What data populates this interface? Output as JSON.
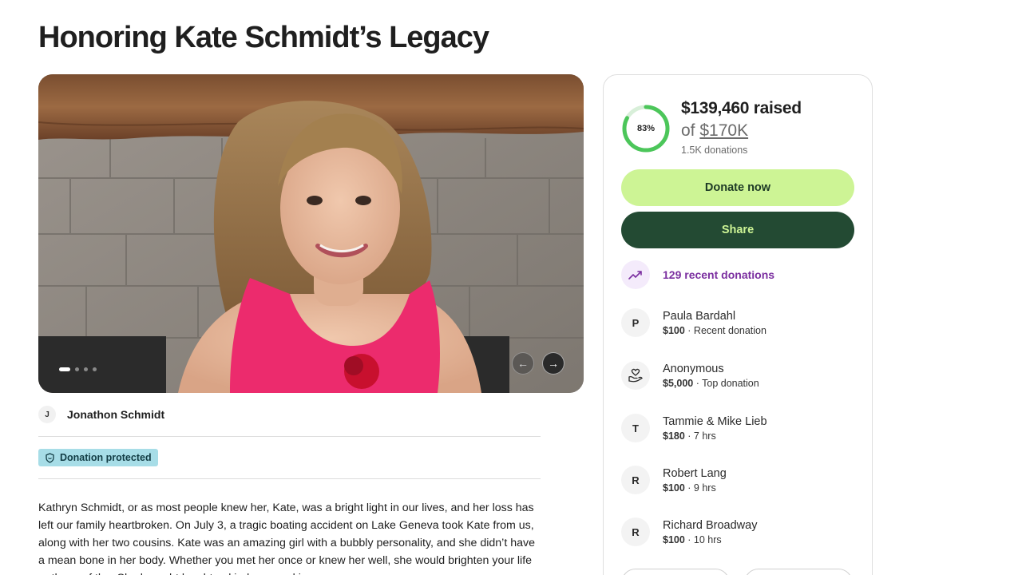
{
  "page": {
    "title": "Honoring Kate Schmidt’s Legacy"
  },
  "gallery": {
    "slides": 4,
    "active_index": 0,
    "prev_icon": "arrow-left-icon",
    "next_icon": "arrow-right-icon"
  },
  "organizer": {
    "initial": "J",
    "name": "Jonathon Schmidt"
  },
  "badge": {
    "label": "Donation protected",
    "icon": "shield-icon",
    "color": "#a7dde7"
  },
  "story": {
    "text": "Kathryn Schmidt, or as most people knew her, Kate, was a bright light in our lives, and her loss has left our family heartbroken. On July 3, a tragic boating accident on Lake Geneva took Kate from us, along with her two cousins. Kate was an amazing girl with a bubbly personality, and she didn’t have a mean bone in her body. Whether you met her once or knew her well, she would brighten your life or those of the. She brought laughter, kindness and joy"
  },
  "fundraiser": {
    "percent_label": "83%",
    "progress": 0.83,
    "raised": "$139,460 raised",
    "goal_prefix": "of",
    "goal_amount": "$170K",
    "donation_count": "1.5K donations",
    "donate_label": "Donate now",
    "share_label": "Share",
    "recent_label": "129 recent donations",
    "accent_color": "#cdf495",
    "dark_color": "#234a33",
    "progress_color": "#4cc65a"
  },
  "donors": [
    {
      "initial": "P",
      "name": "Paula Bardahl",
      "amount": "$100",
      "note": " · Recent donation"
    },
    {
      "initial": "",
      "icon": "heart-hand-icon",
      "name": "Anonymous",
      "amount": "$5,000",
      "note": " · Top donation"
    },
    {
      "initial": "T",
      "name": "Tammie & Mike Lieb",
      "amount": "$180",
      "note": " · 7 hrs"
    },
    {
      "initial": "R",
      "name": "Robert Lang",
      "amount": "$100",
      "note": " · 9 hrs"
    },
    {
      "initial": "R",
      "name": "Richard Broadway",
      "amount": "$100",
      "note": " · 10 hrs"
    }
  ]
}
